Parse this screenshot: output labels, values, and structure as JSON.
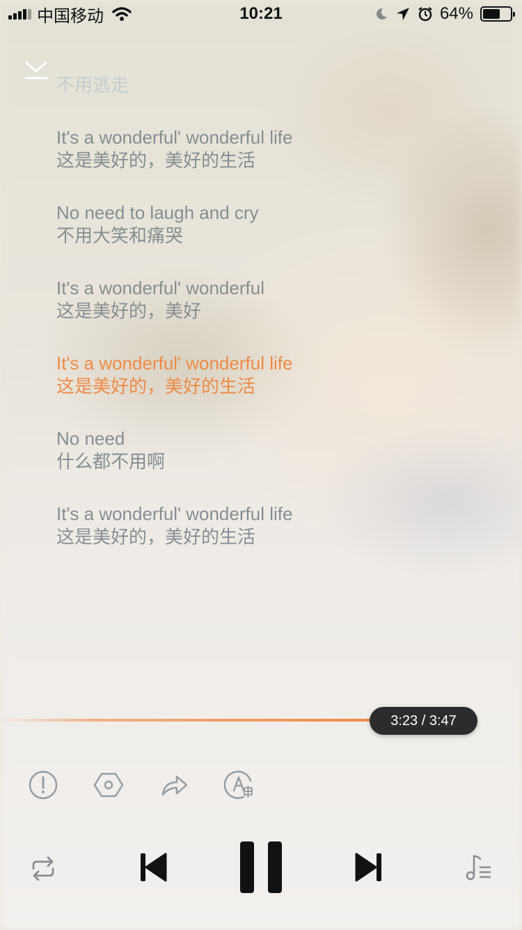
{
  "status_bar": {
    "carrier": "中国移动",
    "time": "10:21",
    "battery_percent": "64%",
    "battery_level": 0.64
  },
  "lyrics": {
    "previous": "不用逃走",
    "lines": [
      {
        "en": "It's a wonderful' wonderful life",
        "zh": "这是美好的，美好的生活"
      },
      {
        "en": "No need to laugh and cry",
        "zh": "不用大笑和痛哭"
      },
      {
        "en": "It's a wonderful' wonderful",
        "zh": "这是美好的，美好"
      },
      {
        "en": "It's a wonderful' wonderful life",
        "zh": "这是美好的，美好的生活"
      },
      {
        "en": "No need",
        "zh": "什么都不用啊"
      },
      {
        "en": "It's a wonderful' wonderful life",
        "zh": "这是美好的，美好的生活"
      }
    ],
    "active_index": 3
  },
  "player": {
    "time_display": "3:23 / 3:47",
    "progress": 0.71,
    "accent_color": "#ef8a45"
  },
  "icons": {
    "collapse": "chevron-down-icon",
    "report": "exclamation-icon",
    "settings": "hexagon-settings-icon",
    "share": "share-icon",
    "translate": "translate-icon",
    "repeat": "repeat-icon",
    "previous": "skip-previous-icon",
    "pause": "pause-icon",
    "next": "skip-next-icon",
    "playlist": "playlist-icon"
  }
}
